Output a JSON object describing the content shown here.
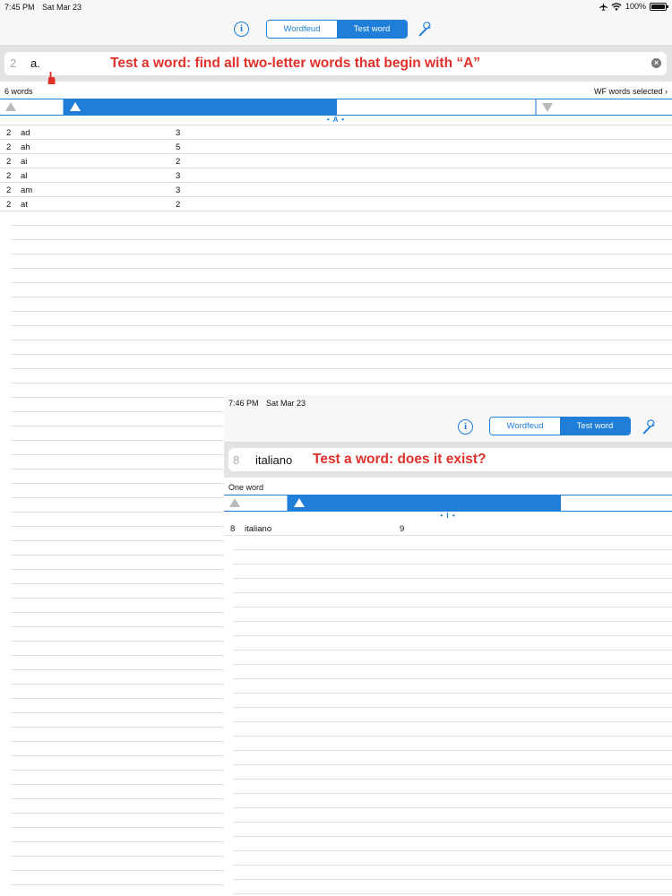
{
  "colors": {
    "accent": "#1e7ed8",
    "annotation": "#e0302a"
  },
  "screen1": {
    "status": {
      "time": "7:45 PM",
      "date": "Sat Mar 23",
      "battery": "100%"
    },
    "nav": {
      "tabs": [
        "Wordfeud",
        "Test word"
      ],
      "active_tab": "Test word"
    },
    "search": {
      "length": "2",
      "query": "a.",
      "annotation": "Test a word: find all two-letter words that begin with “A”"
    },
    "count": "6 words",
    "selection": "WF words selected",
    "section_index": "• A •",
    "rows": [
      {
        "len": "2",
        "word": "ad",
        "score": "3"
      },
      {
        "len": "2",
        "word": "ah",
        "score": "5"
      },
      {
        "len": "2",
        "word": "ai",
        "score": "2"
      },
      {
        "len": "2",
        "word": "al",
        "score": "3"
      },
      {
        "len": "2",
        "word": "am",
        "score": "3"
      },
      {
        "len": "2",
        "word": "at",
        "score": "2"
      }
    ]
  },
  "screen2": {
    "status": {
      "time": "7:46 PM",
      "date": "Sat Mar 23"
    },
    "nav": {
      "tabs": [
        "Wordfeud",
        "Test word"
      ],
      "active_tab": "Test word"
    },
    "search": {
      "length": "8",
      "query": "italiano",
      "annotation": "Test a word: does it exist?"
    },
    "count": "One word",
    "section_index": "• I •",
    "rows": [
      {
        "len": "8",
        "word": "italiano",
        "score": "9"
      }
    ]
  }
}
